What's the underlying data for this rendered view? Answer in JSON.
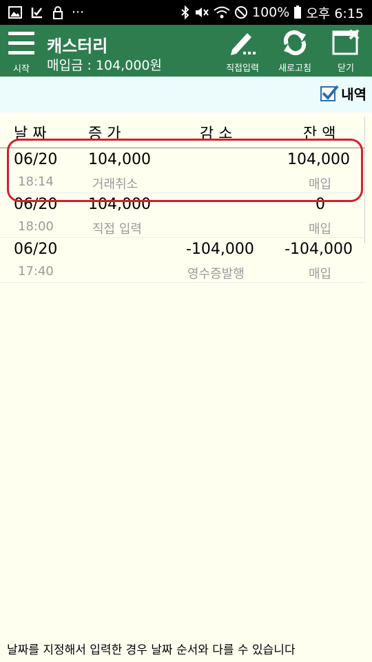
{
  "status_bar": {
    "battery": "100%",
    "clock": "오후 6:15"
  },
  "app_bar": {
    "menu_label": "시작",
    "title": "캐스터리",
    "subtitle": "매입금 : 104,000원",
    "buttons": [
      {
        "label": "직접입력",
        "icon": "pencil-icon"
      },
      {
        "label": "새로고침",
        "icon": "refresh-icon"
      },
      {
        "label": "닫기",
        "icon": "close-window-icon"
      }
    ]
  },
  "filter": {
    "label": "내역",
    "checked": true
  },
  "table": {
    "headers": [
      "날 짜",
      "증 가",
      "감 소",
      "잔 액"
    ],
    "rows": [
      {
        "date": "06/20",
        "time": "18:14",
        "increase": "104,000",
        "increase_note": "거래취소",
        "decrease": "",
        "decrease_note": "",
        "balance": "104,000",
        "balance_note": "매입"
      },
      {
        "date": "06/20",
        "time": "18:00",
        "increase": "104,000",
        "increase_note": "직접 입력",
        "decrease": "",
        "decrease_note": "",
        "balance": "0",
        "balance_note": "매입"
      },
      {
        "date": "06/20",
        "time": "17:40",
        "increase": "",
        "increase_note": "",
        "decrease": "-104,000",
        "decrease_note": "영수증발행",
        "balance": "-104,000",
        "balance_note": "매입"
      }
    ]
  },
  "footer_notice": "날짜를 지정해서 입력한 경우 날짜 순서와 다를 수 있습니다",
  "colors": {
    "app_bar": "#2e7d4f",
    "highlight": "#d0202a",
    "background": "#fffff0",
    "check_row": "#ecfbfb"
  }
}
